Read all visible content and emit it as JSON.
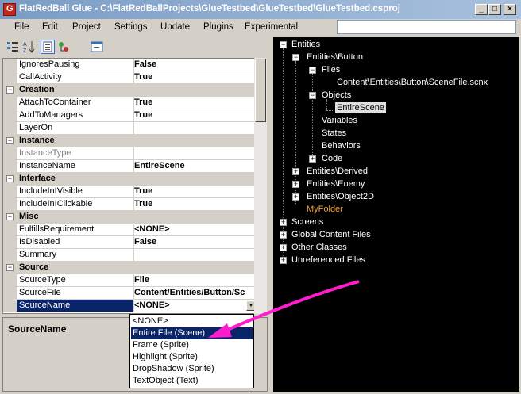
{
  "window": {
    "title": "FlatRedBall Glue - C:\\FlatRedBallProjects\\GlueTestbed\\GlueTestbed\\GlueTestbed.csproj"
  },
  "menu": [
    "File",
    "Edit",
    "Project",
    "Settings",
    "Update",
    "Plugins",
    "Experimental"
  ],
  "search": {
    "value": ""
  },
  "grid": {
    "rows": [
      {
        "name": "IgnoresPausing",
        "value": "False"
      },
      {
        "name": "CallActivity",
        "value": "True"
      },
      {
        "category": "Creation"
      },
      {
        "name": "AttachToContainer",
        "value": "True"
      },
      {
        "name": "AddToManagers",
        "value": "True"
      },
      {
        "name": "LayerOn",
        "value": ""
      },
      {
        "category": "Instance"
      },
      {
        "name": "InstanceType",
        "value": ""
      },
      {
        "name": "InstanceName",
        "value": "EntireScene"
      },
      {
        "category": "Interface"
      },
      {
        "name": "IncludeInIVisible",
        "value": "True"
      },
      {
        "name": "IncludeInIClickable",
        "value": "True"
      },
      {
        "category": "Misc"
      },
      {
        "name": "FulfillsRequirement",
        "value": "<NONE>"
      },
      {
        "name": "IsDisabled",
        "value": "False"
      },
      {
        "name": "Summary",
        "value": ""
      },
      {
        "category": "Source"
      },
      {
        "name": "SourceType",
        "value": "File"
      },
      {
        "name": "SourceFile",
        "value": "Content/Entities/Button/Sc"
      },
      {
        "name": "SourceName",
        "value": "<NONE>"
      }
    ]
  },
  "description": {
    "title": "SourceName"
  },
  "dropdown": {
    "options": [
      "<NONE>",
      "Entire File (Scene)",
      "Frame (Sprite)",
      "Highlight (Sprite)",
      "DropShadow (Sprite)",
      "TextObject (Text)"
    ],
    "highlighted": "Entire File (Scene)"
  },
  "tree": {
    "entities": "Entities",
    "entities_button": "Entities\\Button",
    "files": "Files",
    "scene_file": "Content\\Entities\\Button\\SceneFile.scnx",
    "objects": "Objects",
    "entire_scene": "EntireScene",
    "variables": "Variables",
    "states": "States",
    "behaviors": "Behaviors",
    "code": "Code",
    "entities_derived": "Entities\\Derived",
    "entities_enemy": "Entities\\Enemy",
    "entities_object2d": "Entities\\Object2D",
    "my_folder": "MyFolder",
    "screens": "Screens",
    "global_content": "Global Content Files",
    "other_classes": "Other Classes",
    "unreferenced": "Unreferenced Files"
  },
  "colors": {
    "arrow": "#ff1ccc",
    "selection": "#0a246a",
    "folder": "#f0a030"
  }
}
